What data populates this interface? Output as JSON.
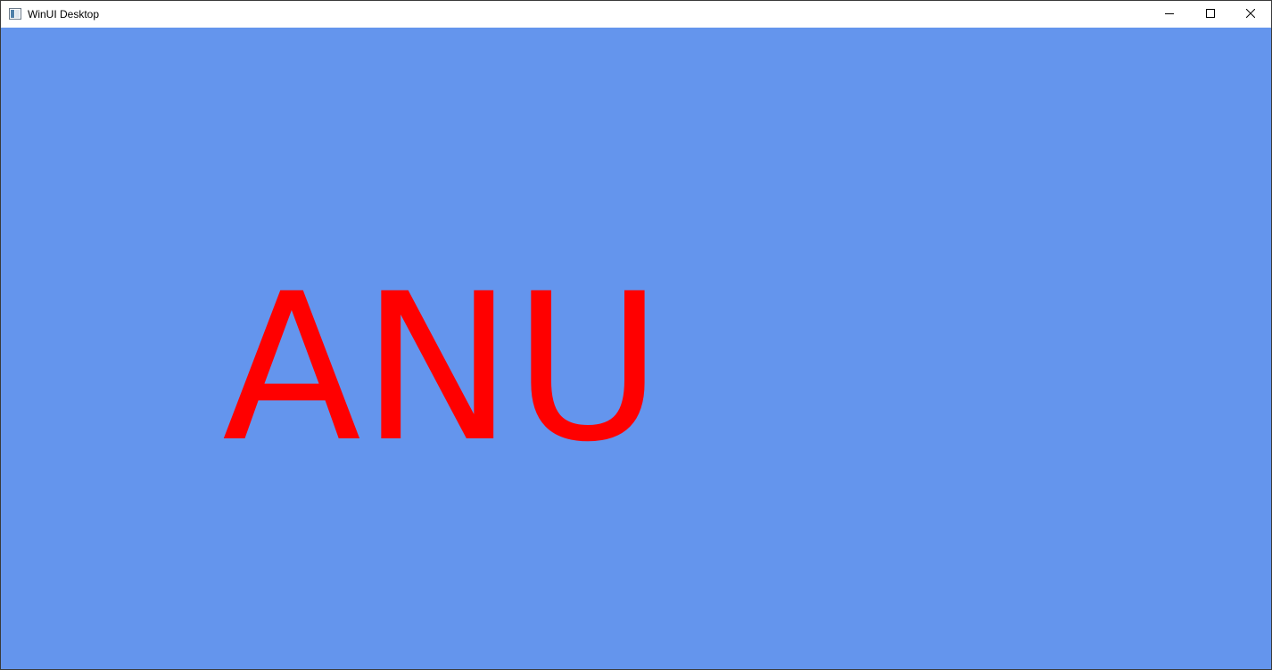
{
  "window": {
    "title": "WinUI Desktop",
    "controls": {
      "minimize_icon": "minimize-icon",
      "maximize_icon": "maximize-icon",
      "close_icon": "close-icon"
    }
  },
  "content": {
    "background_color": "#6495ed",
    "label": {
      "text": "ANU",
      "color": "#ff0000"
    }
  }
}
